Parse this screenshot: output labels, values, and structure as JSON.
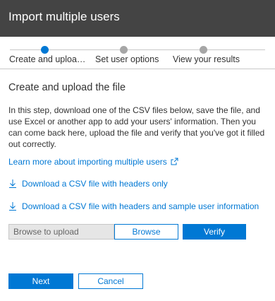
{
  "dialog": {
    "title": "Import multiple users"
  },
  "stepper": {
    "steps": [
      {
        "label": "Create and uploa…",
        "state": "active"
      },
      {
        "label": "Set user options",
        "state": "inactive"
      },
      {
        "label": "View your results",
        "state": "inactive"
      }
    ]
  },
  "content": {
    "heading": "Create and upload the file",
    "description": "In this step, download one of the CSV files below, save the file, and use Excel or another app to add your users' information. Then you can come back here, upload the file and verify that you've got it filled out correctly.",
    "learn_more_link": "Learn more about importing multiple users",
    "download_headers_only": "Download a CSV file with headers only",
    "download_with_sample": "Download a CSV file with headers and sample user information"
  },
  "upload": {
    "field_placeholder": "Browse to upload",
    "browse_label": "Browse",
    "verify_label": "Verify"
  },
  "footer": {
    "next_label": "Next",
    "cancel_label": "Cancel"
  },
  "colors": {
    "accent": "#0078d4",
    "titlebar": "#444444",
    "inactive_step": "#a6a6a6"
  },
  "icons": {
    "external_link": "external-link-icon",
    "download": "download-arrow-icon"
  }
}
